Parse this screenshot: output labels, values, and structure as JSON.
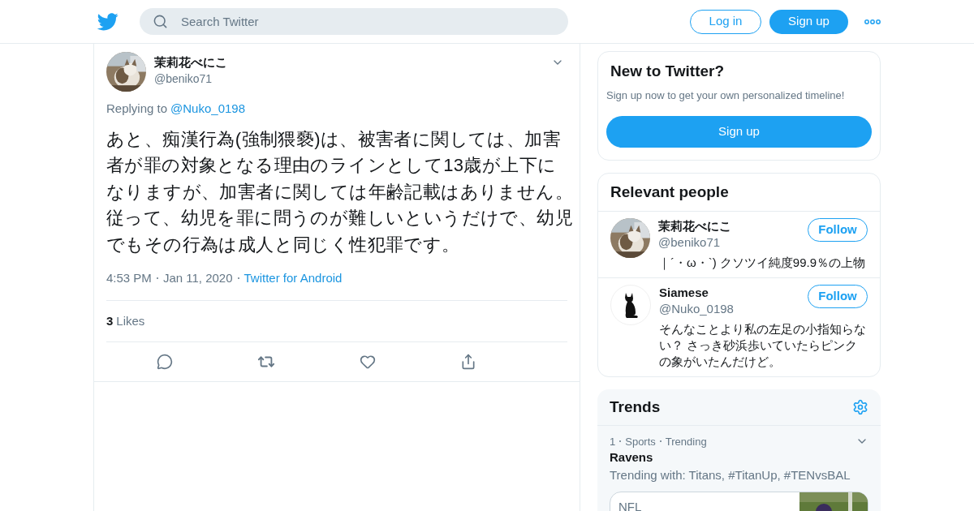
{
  "header": {
    "search": {
      "placeholder": "Search Twitter"
    },
    "login": "Log in",
    "signup": "Sign up"
  },
  "tweet": {
    "name": "茉莉花べにこ",
    "handle": "@beniko71",
    "replying_label": "Replying to",
    "replying_to": "@Nuko_0198",
    "text": "あと、痴漢行為(強制猥褻)は、被害者に関しては、加害者が罪の対象となる理由のラインとして13歳が上下になりますが、加害者に関しては年齢記載はありません。従って、幼児を罪に問うのが難しいというだけで、幼児でもその行為は成人と同じく性犯罪です。",
    "time": "4:53 PM",
    "date": "Jan 11, 2020",
    "source": "Twitter for Android",
    "likes_count": "3",
    "likes_label": "Likes"
  },
  "new_to_twitter": {
    "title": "New to Twitter?",
    "subtitle": "Sign up now to get your own personalized timeline!",
    "button": "Sign up"
  },
  "relevant_people": {
    "title": "Relevant people",
    "people": [
      {
        "name": "茉莉花べにこ",
        "handle": "@beniko71",
        "bio": "｜´・ω・`) クソツイ純度99.9％の上物",
        "button": "Follow"
      },
      {
        "kind": "cat",
        "name": "Siamese",
        "handle": "@Nuko_0198",
        "bio": "そんなことより私の左足の小指知らない？ さっき砂浜歩いていたらピンクの象がいたんだけど。",
        "button": "Follow"
      }
    ]
  },
  "trends": {
    "title": "Trends",
    "items": [
      {
        "rank": "1",
        "category": "Sports",
        "status": "Trending",
        "name": "Ravens",
        "context": "Trending with: Titans, #TitanUp, #TENvsBAL",
        "card": {
          "title": "NFL",
          "kind": "picture"
        }
      }
    ]
  }
}
